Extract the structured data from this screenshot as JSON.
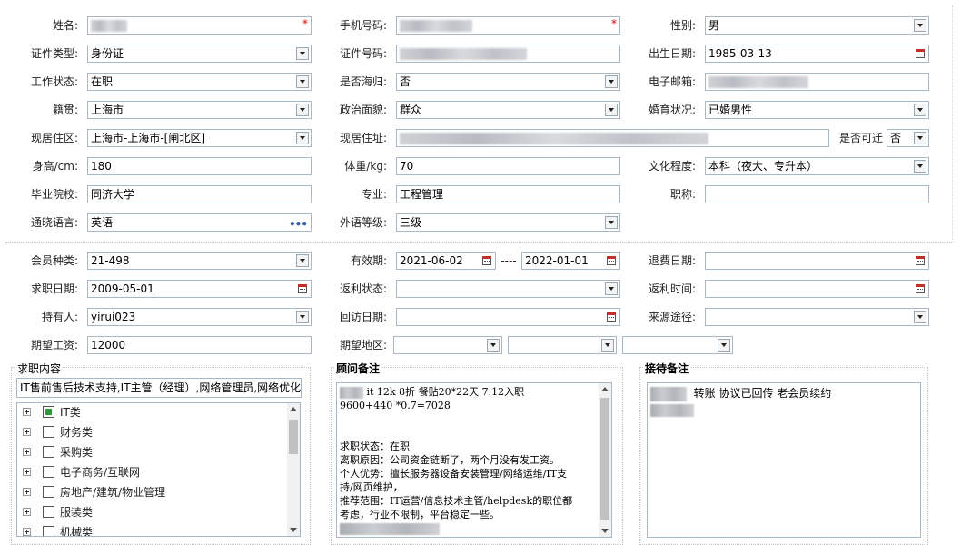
{
  "colors": {
    "border": "#a9b8c8",
    "required": "#dd0000",
    "check_green": "#2f9a3c"
  },
  "basic": {
    "name": {
      "label": "姓名:",
      "value": ""
    },
    "phone": {
      "label": "手机号码:",
      "value": ""
    },
    "gender": {
      "label": "性别:",
      "value": "男"
    },
    "id_type": {
      "label": "证件类型:",
      "value": "身份证"
    },
    "id_number": {
      "label": "证件号码:",
      "value": ""
    },
    "birth": {
      "label": "出生日期:",
      "value": "1985-03-13"
    },
    "work_status": {
      "label": "工作状态:",
      "value": "在职"
    },
    "returnee": {
      "label": "是否海归:",
      "value": "否"
    },
    "email": {
      "label": "电子邮箱:",
      "value": ""
    },
    "native": {
      "label": "籍贯:",
      "value": "上海市"
    },
    "politics": {
      "label": "政治面貌:",
      "value": "群众"
    },
    "marital": {
      "label": "婚育状况:",
      "value": "已婚男性"
    },
    "residence_area": {
      "label": "现居住区:",
      "value": "上海市-上海市-[闸北区]"
    },
    "address": {
      "label": "现居住址:",
      "value": ""
    },
    "relocate": {
      "label": "是否可迁",
      "value": "否"
    },
    "height": {
      "label": "身高/cm:",
      "value": "180"
    },
    "weight": {
      "label": "体重/kg:",
      "value": "70"
    },
    "education": {
      "label": "文化程度:",
      "value": "本科（夜大、专升本）"
    },
    "school": {
      "label": "毕业院校:",
      "value": "同济大学"
    },
    "major": {
      "label": "专业:",
      "value": "工程管理"
    },
    "title": {
      "label": "职称:",
      "value": ""
    },
    "language": {
      "label": "通晓语言:",
      "value": "英语",
      "more": "•••"
    },
    "language_level": {
      "label": "外语等级:",
      "value": "三级"
    }
  },
  "member": {
    "type": {
      "label": "会员种类:",
      "value": "21-498"
    },
    "validity": {
      "label": "有效期:",
      "from": "2021-06-02",
      "sep": "----",
      "to": "2022-01-01"
    },
    "refund_date": {
      "label": "退费日期:",
      "value": ""
    },
    "job_date": {
      "label": "求职日期:",
      "value": "2009-05-01"
    },
    "rebate_status": {
      "label": "返利状态:",
      "value": ""
    },
    "rebate_time": {
      "label": "返利时间:",
      "value": ""
    },
    "holder": {
      "label": "持有人:",
      "value": "yirui023"
    },
    "visit_date": {
      "label": "回访日期:",
      "value": ""
    },
    "source": {
      "label": "来源途径:",
      "value": ""
    },
    "salary": {
      "label": "期望工资:",
      "value": "12000"
    },
    "region": {
      "label": "期望地区:",
      "values": [
        "",
        "",
        ""
      ]
    }
  },
  "job_content": {
    "title": "求职内容",
    "summary": "IT售前售后技术支持,IT主管（经理）,网络管理员,网络优化",
    "tree": [
      {
        "label": "IT类",
        "state": "partial"
      },
      {
        "label": "财务类",
        "state": "unchecked"
      },
      {
        "label": "采购类",
        "state": "unchecked"
      },
      {
        "label": "电子商务/互联网",
        "state": "unchecked"
      },
      {
        "label": "房地产/建筑/物业管理",
        "state": "unchecked"
      },
      {
        "label": "服装类",
        "state": "unchecked"
      },
      {
        "label": "机械类",
        "state": "unchecked"
      }
    ]
  },
  "advisor_notes": {
    "title": "顾问备注",
    "lines": [
      "it  12k  8折  餐贴20*22天  7.12入职",
      "9600+440  *0.7=7028",
      "",
      "",
      "求职状态：在职",
      "离职原因：公司资金链断了，两个月没有发工资。",
      "个人优势：擅长服务器设备安装管理/网络运维/IT支",
      "持/网页维护，",
      "推荐范围：IT运营/信息技术主管/helpdesk的职位都",
      "考虑，行业不限制，平台稳定一些。"
    ]
  },
  "reception_notes": {
    "title": "接待备注",
    "text": "转账 协议已回传  老会员续约"
  }
}
